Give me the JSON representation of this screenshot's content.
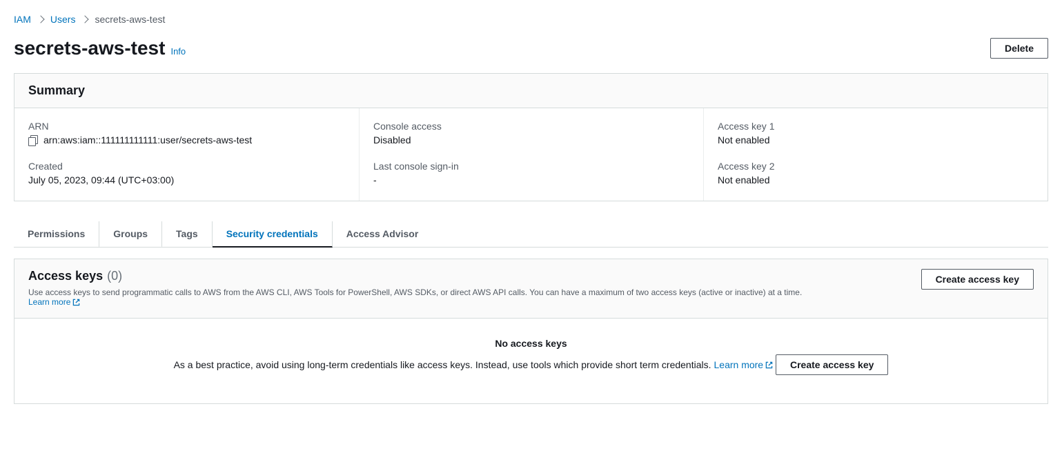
{
  "breadcrumb": {
    "root": "IAM",
    "section": "Users",
    "current": "secrets-aws-test"
  },
  "header": {
    "title": "secrets-aws-test",
    "info": "Info",
    "delete": "Delete"
  },
  "summary": {
    "heading": "Summary",
    "arn_label": "ARN",
    "arn_value": "arn:aws:iam::111111111111:user/secrets-aws-test",
    "created_label": "Created",
    "created_value": "July 05, 2023, 09:44 (UTC+03:00)",
    "console_access_label": "Console access",
    "console_access_value": "Disabled",
    "last_signin_label": "Last console sign-in",
    "last_signin_value": "-",
    "ak1_label": "Access key 1",
    "ak1_value": "Not enabled",
    "ak2_label": "Access key 2",
    "ak2_value": "Not enabled"
  },
  "tabs": {
    "permissions": "Permissions",
    "groups": "Groups",
    "tags": "Tags",
    "security": "Security credentials",
    "advisor": "Access Advisor"
  },
  "access_keys": {
    "title": "Access keys",
    "count": "(0)",
    "description": "Use access keys to send programmatic calls to AWS from the AWS CLI, AWS Tools for PowerShell, AWS SDKs, or direct AWS API calls. You can have a maximum of two access keys (active or inactive) at a time.",
    "learn_more": "Learn more",
    "create_button": "Create access key",
    "empty_title": "No access keys",
    "empty_text": "As a best practice, avoid using long-term credentials like access keys. Instead, use tools which provide short term credentials.",
    "empty_learn_more": "Learn more",
    "empty_create": "Create access key"
  }
}
